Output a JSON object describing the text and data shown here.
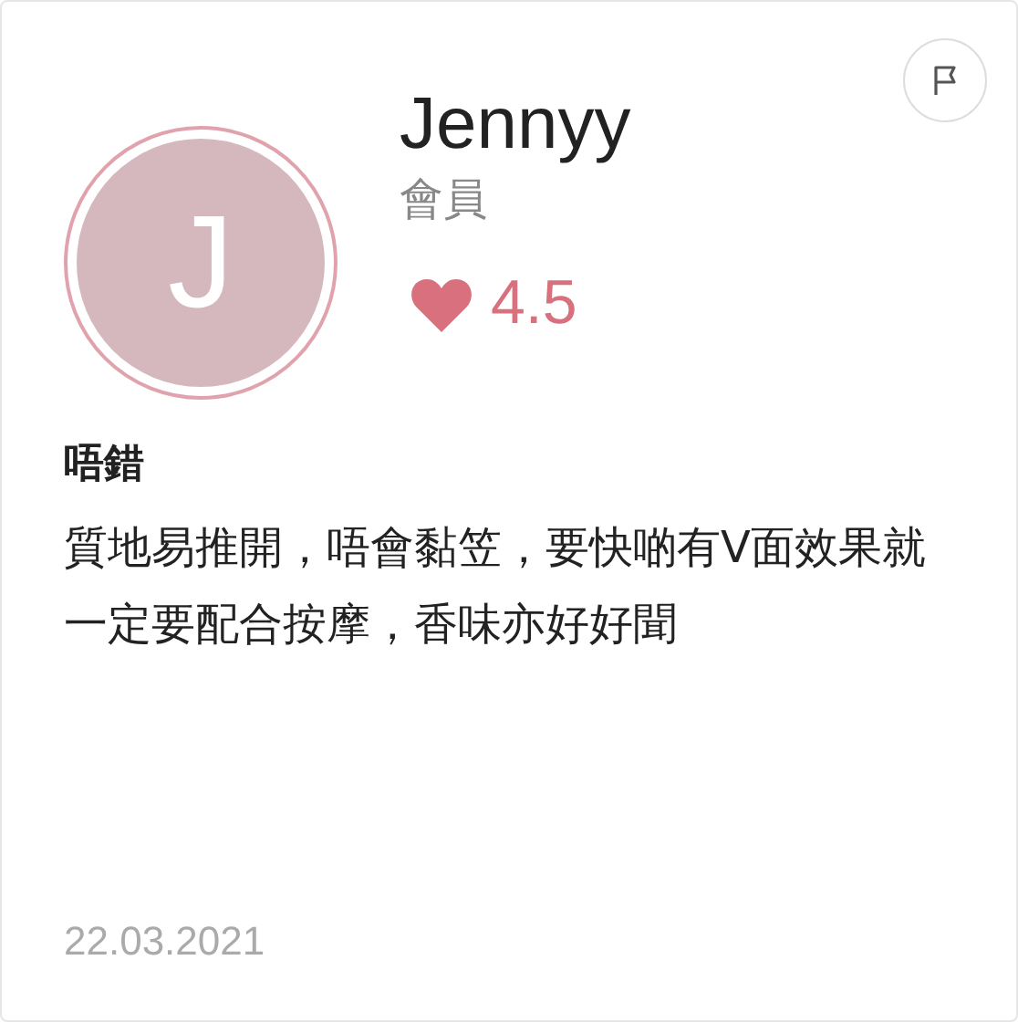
{
  "reviewer": {
    "initial": "J",
    "name": "Jennyy",
    "role": "會員",
    "rating": "4.5"
  },
  "review": {
    "title": "唔錯",
    "body": "質地易推開，唔會黏笠，要快啲有V面效果就一定要配合按摩，香味亦好好聞",
    "date": "22.03.2021"
  }
}
